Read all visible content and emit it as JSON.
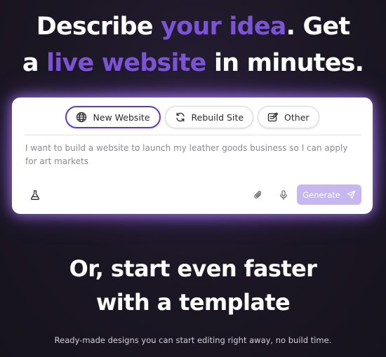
{
  "hero": {
    "line1_start": "Describe ",
    "line1_accent": "your idea",
    "line1_end": ". Get",
    "line2_start": "a ",
    "line2_accent": "live website",
    "line2_end": " in minutes."
  },
  "tabs": [
    {
      "label": "New Website",
      "icon": "globe-icon",
      "active": true
    },
    {
      "label": "Rebuild Site",
      "icon": "refresh-icon",
      "active": false
    },
    {
      "label": "Other",
      "icon": "edit-note-icon",
      "active": false
    }
  ],
  "prompt": {
    "value": "I want to build a website to launch my leather goods business so I can apply for art markets"
  },
  "toolbar": {
    "left_icon": "flask-icon",
    "attach_icon": "paperclip-icon",
    "mic_icon": "microphone-icon",
    "generate_label": "Generate",
    "generate_icon": "send-icon"
  },
  "template_section": {
    "title_line1": "Or, start even faster",
    "title_line2": "with a template",
    "subtitle": "Ready-made designs you can start editing right away, no build time."
  },
  "colors": {
    "background": "#1b1623",
    "accent": "#7b54d6",
    "active_tab_border": "#5b3fc0",
    "generate_button": "#c6b7ee",
    "card_glow": "#b282ff"
  }
}
